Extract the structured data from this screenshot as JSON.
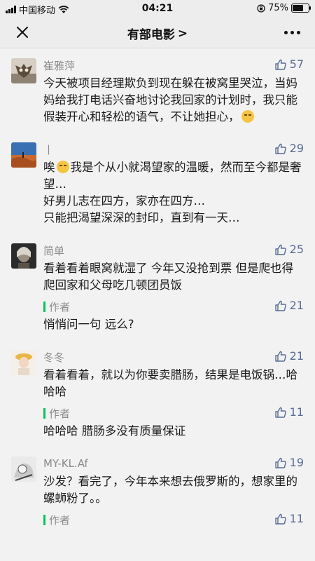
{
  "status_bar": {
    "carrier": "中国移动",
    "time": "04:21",
    "battery": "75%",
    "battery_level": 0.75
  },
  "nav": {
    "title": "有部电影",
    "title_arrow": ">"
  },
  "comments": [
    {
      "user": "崔雅萍",
      "likes": "57",
      "avatar_icon": "owl-avatar",
      "text": "今天被项目经理欺负到现在躲在被窝里哭泣，当妈妈给我打电话兴奋地讨论我回家的计划时，我只能假装开心和轻松的语气，不让她担心，"
    },
    {
      "user": "丨",
      "likes": "29",
      "avatar_icon": "desert-avatar",
      "text_before_emoji": "唉",
      "text": "我是个从小就渴望家的温暖，然而至今都是奢望…\n好男儿志在四方，家亦在四方…\n只能把渴望深深的封印，直到有一天…"
    },
    {
      "user": "简单",
      "likes": "25",
      "avatar_icon": "portrait-avatar",
      "text": "看着看着眼窝就湿了 今年又没抢到票 但是爬也得爬回家和父母吃几顿团员饭",
      "reply": {
        "label": "作者",
        "likes": "21",
        "text": "悄悄问一句 远么?"
      }
    },
    {
      "user": "冬冬",
      "likes": "21",
      "avatar_icon": "girl-avatar",
      "text": "看着看着，就以为你要卖腊肠，结果是电饭锅…哈哈哈",
      "reply": {
        "label": "作者",
        "likes": "11",
        "text": "哈哈哈 腊肠多没有质量保证"
      }
    },
    {
      "user": "MY-KL.Af",
      "likes": "19",
      "avatar_icon": "anime-avatar",
      "text": "沙发？看完了，今年本来想去俄罗斯的，想家里的螺蛳粉了。。",
      "reply": {
        "label": "作者",
        "likes": "11",
        "text": ""
      }
    }
  ]
}
